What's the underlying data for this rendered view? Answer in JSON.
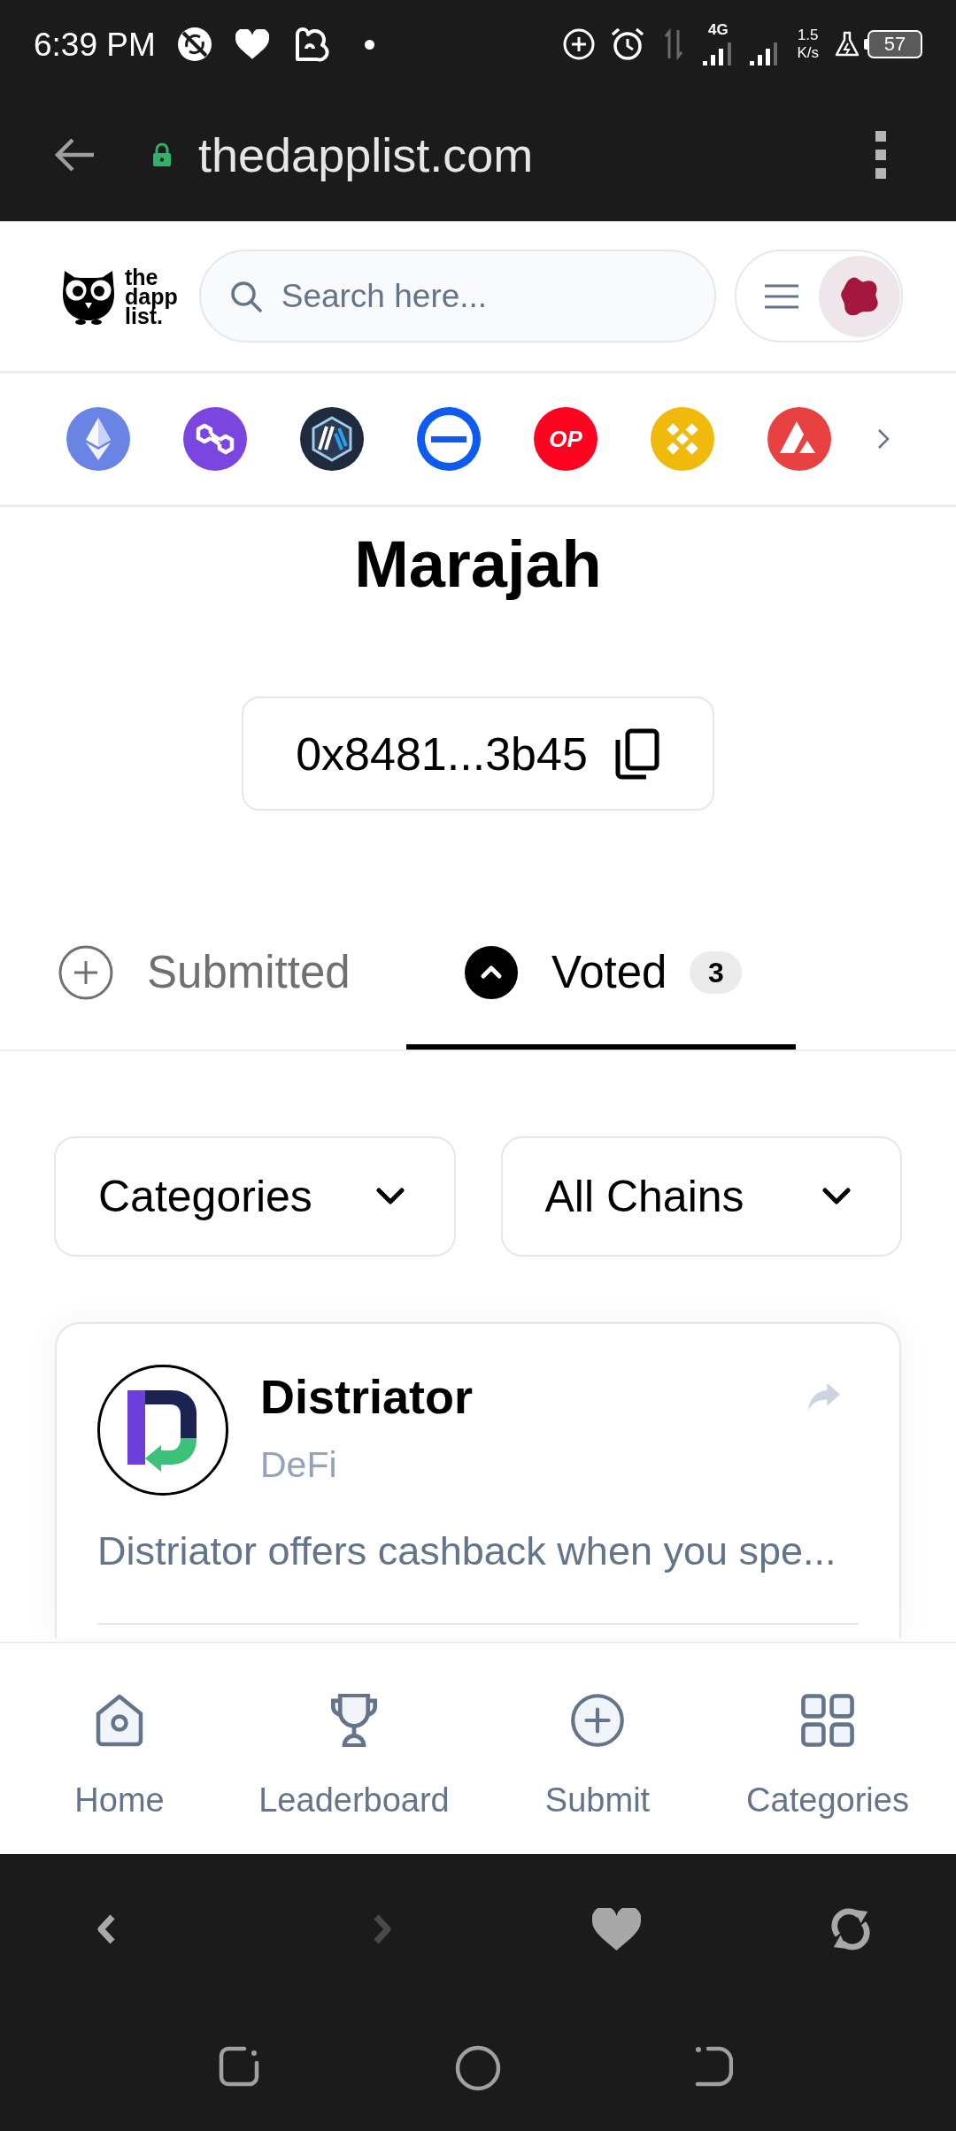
{
  "status_bar": {
    "time": "6:39 PM",
    "network_type": "4G",
    "speed_value": "1.5",
    "speed_unit": "K/s",
    "battery": "57"
  },
  "browser": {
    "url": "thedapplist.com"
  },
  "header": {
    "logo_text": "the dapp list.",
    "search": {
      "placeholder": "Search here..."
    }
  },
  "chains": [
    {
      "kind": "diamond",
      "color": "#6a84e6"
    },
    {
      "kind": "links",
      "color": "#7b45e0"
    },
    {
      "kind": "hexagon",
      "color": "#1f2a3c"
    },
    {
      "kind": "ring",
      "color": "#0f5bf2"
    },
    {
      "kind": "text",
      "label": "OP",
      "color": "#ff0420"
    },
    {
      "kind": "tiles",
      "color": "#f0b90b"
    },
    {
      "kind": "triangle",
      "color": "#e84142"
    }
  ],
  "profile": {
    "name": "Marajah",
    "address": "0x8481...3b45"
  },
  "tabs": [
    {
      "kind": "submitted",
      "label": "Submitted",
      "selected": false
    },
    {
      "kind": "voted",
      "label": "Voted",
      "selected": true,
      "count": "3"
    }
  ],
  "filters": [
    {
      "label": "Categories"
    },
    {
      "label": "All Chains"
    }
  ],
  "dapps": [
    {
      "name": "Distriator",
      "category": "DeFi",
      "description": "Distriator offers cashback when you spe..."
    }
  ],
  "bottom_nav": [
    {
      "kind": "home",
      "label": "Home"
    },
    {
      "kind": "trophy",
      "label": "Leaderboard"
    },
    {
      "kind": "plus",
      "label": "Submit"
    },
    {
      "kind": "grid",
      "label": "Categories"
    }
  ],
  "browser_toolbar": [
    {
      "kind": "back",
      "disabled": false
    },
    {
      "kind": "forward",
      "disabled": true
    },
    {
      "kind": "heart",
      "disabled": false
    },
    {
      "kind": "reload",
      "disabled": false
    }
  ]
}
